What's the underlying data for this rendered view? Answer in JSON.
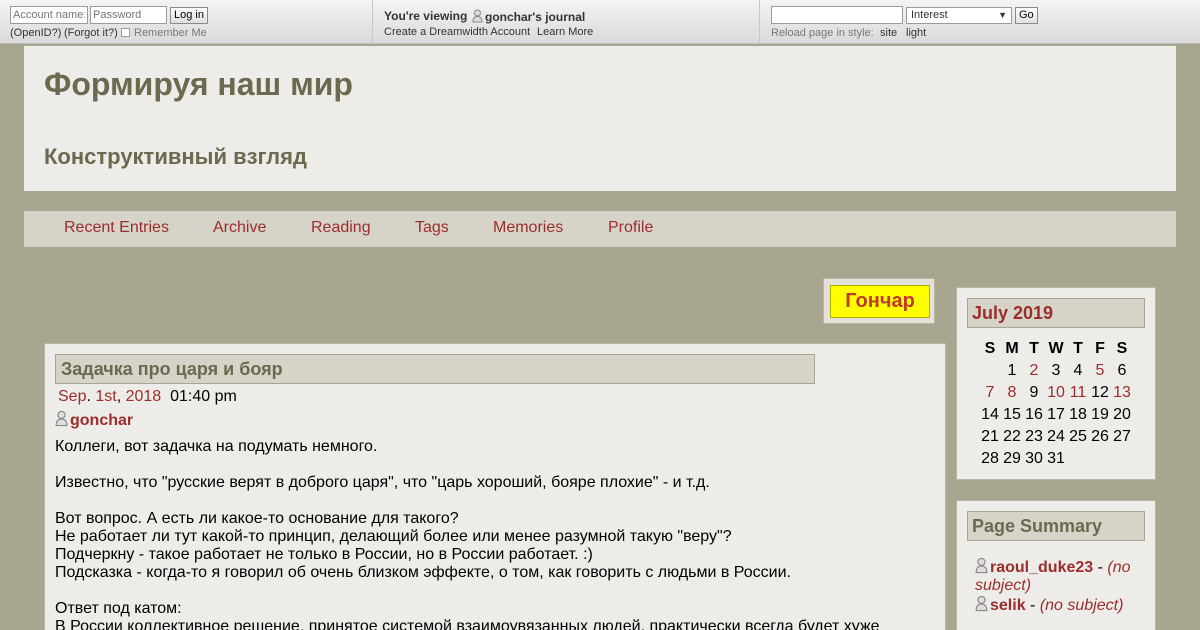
{
  "topbar": {
    "account_placeholder": "Account name:",
    "password_placeholder": "Password",
    "login_label": "Log in",
    "openid_label": "(OpenID?)",
    "forgot_label": "(Forgot it?)",
    "remember_label": "Remember Me",
    "viewing_prefix": "You're viewing",
    "viewing_user": "gonchar's journal",
    "create_account": "Create a Dreamwidth Account",
    "learn_more": "Learn More",
    "search_value": "",
    "search_type": "Interest",
    "go_label": "Go",
    "reload_label": "Reload page in style:",
    "style_site": "site",
    "style_light": "light"
  },
  "header": {
    "title": "Формируя наш мир",
    "subtitle": "Конструктивный взгляд"
  },
  "nav": [
    "Recent Entries",
    "Archive",
    "Reading",
    "Tags",
    "Memories",
    "Profile"
  ],
  "banner": {
    "text": "Гончар"
  },
  "entry": {
    "title": "Задачка про царя и бояр",
    "date_month": "Sep",
    "date_day": "1st",
    "date_year": "2018",
    "time": "01:40 pm",
    "author": "gonchar",
    "body": [
      "Коллеги, вот задачка на подумать немного.",
      "",
      "Известно, что \"русские верят в доброго царя\", что \"царь хороший, бояре плохие\" - и т.д.",
      "",
      "Вот вопрос. А есть ли какое-то основание для такого?",
      "Не работает ли тут какой-то принцип, делающий более или менее разумной такую \"веру\"?",
      "Подчеркну - такое работает не только в России, но в России работает. :)",
      "Подсказка - когда-то я говорил об очень близком эффекте, о том, как говорить с людьми в России.",
      "",
      "Ответ под катом:",
      "В России коллективное решение, принятое системой взаимоувязанных людей, практически всегда будет хуже"
    ]
  },
  "calendar": {
    "title": "July 2019",
    "days_header": [
      "S",
      "M",
      "T",
      "W",
      "T",
      "F",
      "S"
    ],
    "weeks": [
      [
        "",
        "1",
        "2",
        "3",
        "4",
        "5",
        "6"
      ],
      [
        "7",
        "8",
        "9",
        "10",
        "11",
        "12",
        "13"
      ],
      [
        "14",
        "15",
        "16",
        "17",
        "18",
        "19",
        "20"
      ],
      [
        "21",
        "22",
        "23",
        "24",
        "25",
        "26",
        "27"
      ],
      [
        "28",
        "29",
        "30",
        "31",
        "",
        "",
        ""
      ]
    ],
    "linked_days": [
      "2",
      "5",
      "7",
      "8",
      "10",
      "11",
      "13"
    ]
  },
  "summary": {
    "title": "Page Summary",
    "items": [
      {
        "user": "raoul_duke23",
        "sep": " - ",
        "subject": "(no subject)"
      },
      {
        "user": "selik",
        "sep": " - ",
        "subject": "(no subject)"
      }
    ]
  },
  "colors": {
    "link": "#9b2d2d",
    "heading": "#6b6a4f",
    "background": "#a8a68f",
    "panel": "#eeece8",
    "banner_yellow": "#ffff00"
  }
}
